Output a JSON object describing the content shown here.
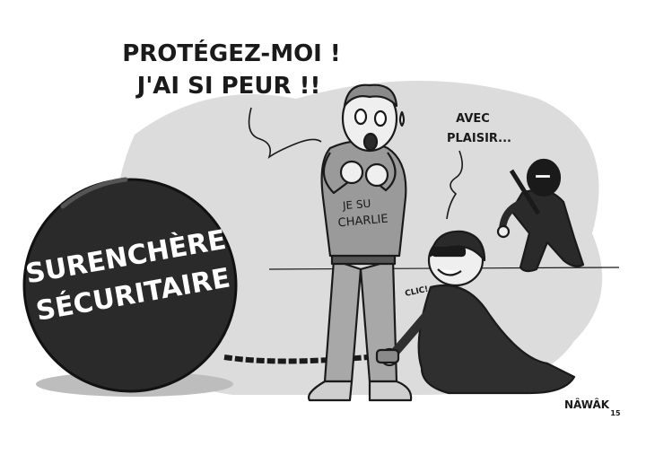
{
  "speech_left": {
    "line1": "PROTÉGEZ-MOI !",
    "line2": "J'AI SI PEUR !!"
  },
  "speech_right": {
    "line1": "AVEC",
    "line2": "PLAISIR..."
  },
  "ball": {
    "line1": "SURENCHÈRE",
    "line2": "SÉCURITAIRE"
  },
  "shirt": {
    "line1": "JE SU",
    "line2": "CHARLIE"
  },
  "sound_effect": "CLIC!",
  "signature": {
    "name": "NÂWÂK",
    "year": "15"
  },
  "colors": {
    "background_blob": "#dcdcdc",
    "ball": "#2a2a2a",
    "outline": "#1a1a1a",
    "sweater": "#9a9a9a",
    "trousers": "#a8a8a8",
    "suit": "#2f2f2f",
    "skin": "#efefef"
  }
}
